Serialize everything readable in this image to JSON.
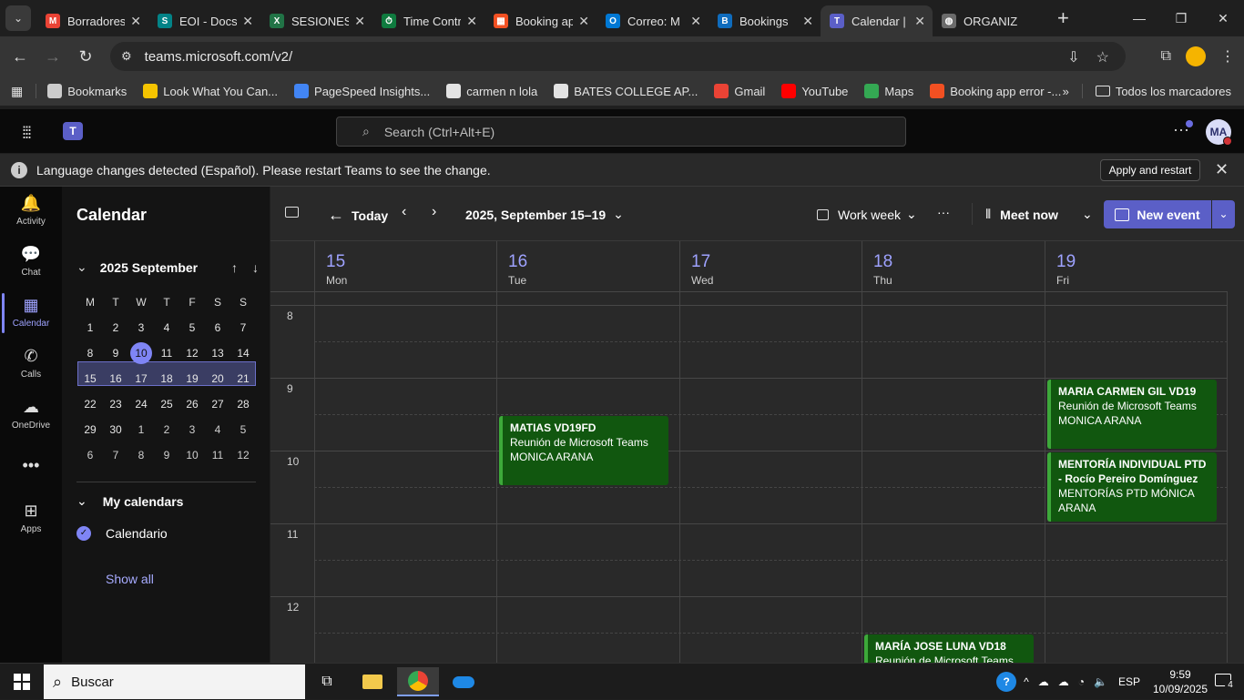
{
  "browser": {
    "tabs": [
      {
        "label": "Borradores",
        "favicon_color": "#ea4335",
        "favicon_glyph": "M",
        "active": false
      },
      {
        "label": "EOI - Docs",
        "favicon_color": "#038387",
        "favicon_glyph": "S",
        "active": false
      },
      {
        "label": "SESIONES",
        "favicon_color": "#217346",
        "favicon_glyph": "X",
        "active": false
      },
      {
        "label": "Time Control",
        "favicon_color": "#0f7b3f",
        "favicon_glyph": "⏱",
        "active": false
      },
      {
        "label": "Booking app",
        "favicon_color": "#f25022",
        "favicon_glyph": "▦",
        "active": false
      },
      {
        "label": "Correo: M",
        "favicon_color": "#0078d4",
        "favicon_glyph": "O",
        "active": false
      },
      {
        "label": "Bookings",
        "favicon_color": "#0f6cbd",
        "favicon_glyph": "B",
        "active": false
      },
      {
        "label": "Calendar |",
        "favicon_color": "#5b5fc7",
        "favicon_glyph": "T",
        "active": true
      },
      {
        "label": "ORGANIZ",
        "favicon_color": "#6b6b6b",
        "favicon_glyph": "◍",
        "active": false
      }
    ],
    "new_tab_glyph": "+",
    "window_controls": [
      "—",
      "❐",
      "✕"
    ],
    "url": "teams.microsoft.com/v2/",
    "bookmarks": [
      {
        "label": "Bookmarks",
        "icon_color": "#cccccc"
      },
      {
        "label": "Look What You Can...",
        "icon_color": "#f5c400"
      },
      {
        "label": "PageSpeed Insights...",
        "icon_color": "#4285f4"
      },
      {
        "label": "carmen n lola",
        "icon_color": "#e3e3e3"
      },
      {
        "label": "BATES COLLEGE AP...",
        "icon_color": "#e3e3e3"
      },
      {
        "label": "Gmail",
        "icon_color": "#ea4335"
      },
      {
        "label": "YouTube",
        "icon_color": "#ff0000"
      },
      {
        "label": "Maps",
        "icon_color": "#34a853"
      },
      {
        "label": "Booking app error -...",
        "icon_color": "#f25022"
      }
    ],
    "bookmarks_overflow": "»",
    "all_bookmarks": "Todos los marcadores"
  },
  "teams": {
    "search_placeholder": "Search (Ctrl+Alt+E)",
    "avatar_initials": "MA",
    "info_message": "Language changes detected (Español). Please restart Teams to see the change.",
    "restart_button": "Apply and restart",
    "rail": [
      {
        "label": "Activity",
        "icon": "bell-icon",
        "glyph": "🔔"
      },
      {
        "label": "Chat",
        "icon": "chat-icon",
        "glyph": "💬"
      },
      {
        "label": "Calendar",
        "icon": "calendar-icon",
        "glyph": "▦",
        "active": true
      },
      {
        "label": "Calls",
        "icon": "phone-icon",
        "glyph": "✆"
      },
      {
        "label": "OneDrive",
        "icon": "cloud-icon",
        "glyph": "☁"
      },
      {
        "label": "",
        "icon": "more-icon",
        "glyph": "•••"
      },
      {
        "label": "Apps",
        "icon": "apps-icon",
        "glyph": "⊞"
      }
    ]
  },
  "left_pane": {
    "title": "Calendar",
    "month_label": "2025 September",
    "weekdays": [
      "M",
      "T",
      "W",
      "T",
      "F",
      "S",
      "S"
    ],
    "weeks": [
      [
        "1",
        "2",
        "3",
        "4",
        "5",
        "6",
        "7"
      ],
      [
        "8",
        "9",
        "10",
        "11",
        "12",
        "13",
        "14"
      ],
      [
        "15",
        "16",
        "17",
        "18",
        "19",
        "20",
        "21"
      ],
      [
        "22",
        "23",
        "24",
        "25",
        "26",
        "27",
        "28"
      ],
      [
        "29",
        "30",
        "1",
        "2",
        "3",
        "4",
        "5"
      ],
      [
        "6",
        "7",
        "8",
        "9",
        "10",
        "11",
        "12"
      ]
    ],
    "today": "10",
    "my_calendars_label": "My calendars",
    "calendar_item": "Calendario",
    "show_all": "Show all"
  },
  "toolbar": {
    "today": "Today",
    "range": "2025, September 15–19",
    "view": "Work week",
    "more": "···",
    "meet_now": "Meet now",
    "new_event": "New event"
  },
  "days": [
    {
      "num": "15",
      "name": "Mon"
    },
    {
      "num": "16",
      "name": "Tue"
    },
    {
      "num": "17",
      "name": "Wed"
    },
    {
      "num": "18",
      "name": "Thu"
    },
    {
      "num": "19",
      "name": "Fri"
    }
  ],
  "hours": [
    "8",
    "9",
    "10",
    "11",
    "12"
  ],
  "events": [
    {
      "day": 1,
      "start": 9.5,
      "end": 10.45,
      "title": "MATIAS VD19FD",
      "lines": [
        "Reunión de Microsoft Teams",
        "MONICA ARANA"
      ]
    },
    {
      "day": 4,
      "start": 9.0,
      "end": 9.95,
      "title": "MARIA CARMEN GIL VD19",
      "lines": [
        "Reunión de Microsoft Teams",
        "MONICA ARANA"
      ]
    },
    {
      "day": 4,
      "start": 10.0,
      "end": 10.95,
      "title": "MENTORÍA INDIVIDUAL PTD - Rocío Pereiro Domínguez",
      "lines": [
        "MENTORÍAS PTD MÓNICA ARANA"
      ]
    },
    {
      "day": 3,
      "start": 12.5,
      "end": 13.4,
      "title": "MARÍA JOSE LUNA VD18",
      "lines": [
        "Reunión de Microsoft Teams"
      ]
    }
  ],
  "taskbar": {
    "search_placeholder": "Buscar",
    "language": "ESP",
    "time": "9:59",
    "date": "10/09/2025",
    "notifications": "4"
  }
}
